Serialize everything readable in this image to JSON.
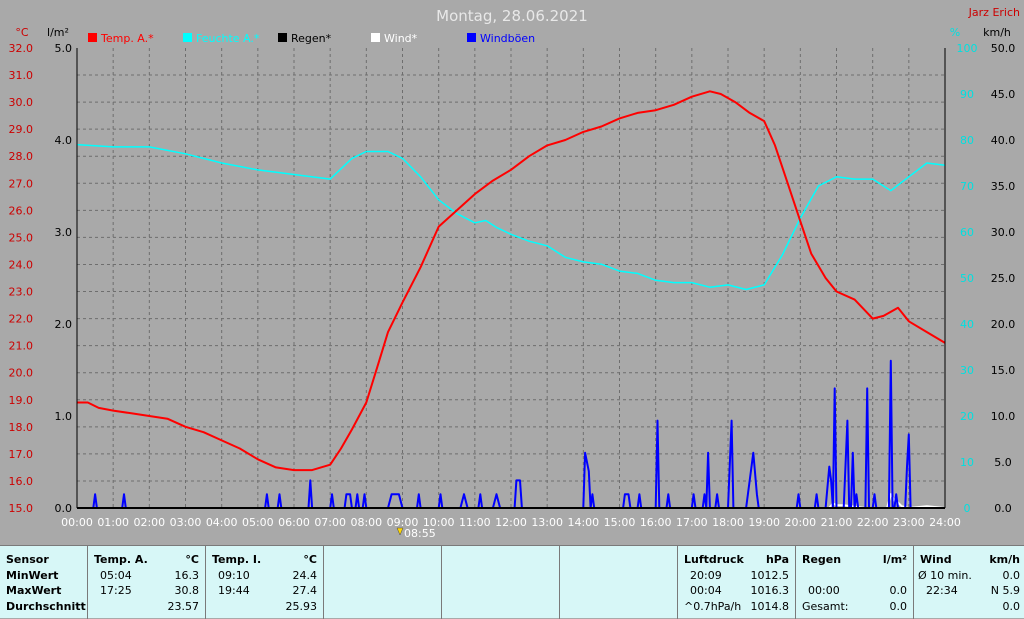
{
  "header": {
    "title": "Montag, 28.06.2021",
    "author": "Jarz Erich",
    "unit_left_temp": "°C",
    "unit_left_rain": "l/m²",
    "unit_right_hum": "%",
    "unit_right_wind": "km/h",
    "time_marker": "08:55"
  },
  "legend": [
    {
      "label": "Temp. A.*",
      "color": "#ff0000"
    },
    {
      "label": "Feuchte A.*",
      "color": "#00ffff"
    },
    {
      "label": "Regen*",
      "color": "#000000"
    },
    {
      "label": "Wind*",
      "color": "#ffffff"
    },
    {
      "label": "Windböen",
      "color": "#0000ff"
    }
  ],
  "chart_data": {
    "type": "line",
    "title": "Montag, 28.06.2021",
    "x_ticks": [
      "00:00",
      "01:00",
      "02:00",
      "03:00",
      "04:00",
      "05:00",
      "06:00",
      "07:00",
      "08:00",
      "09:00",
      "10:00",
      "11:00",
      "12:00",
      "13:00",
      "14:00",
      "15:00",
      "16:00",
      "17:00",
      "18:00",
      "19:00",
      "20:00",
      "21:00",
      "22:00",
      "23:00",
      "24:00"
    ],
    "xlim_hours": [
      0,
      24
    ],
    "axes": {
      "temp": {
        "label": "°C",
        "lim": [
          15.0,
          32.0
        ],
        "ticks": [
          "32.0",
          "31.0",
          "30.0",
          "29.0",
          "28.0",
          "27.0",
          "26.0",
          "25.0",
          "24.0",
          "23.0",
          "22.0",
          "21.0",
          "20.0",
          "19.0",
          "18.0",
          "17.0",
          "16.0",
          "15.0"
        ]
      },
      "rain": {
        "label": "l/m²",
        "lim": [
          0.0,
          5.0
        ],
        "ticks": [
          "5.0",
          "4.0",
          "3.0",
          "2.0",
          "1.0",
          "0.0"
        ]
      },
      "humidity": {
        "label": "%",
        "lim": [
          0,
          100
        ],
        "ticks": [
          "100",
          "90",
          "80",
          "70",
          "60",
          "50",
          "40",
          "30",
          "20",
          "10",
          "0"
        ]
      },
      "wind": {
        "label": "km/h",
        "lim": [
          0.0,
          50.0
        ],
        "ticks": [
          "50.0",
          "45.0",
          "40.0",
          "35.0",
          "30.0",
          "25.0",
          "20.0",
          "15.0",
          "10.0",
          "5.0",
          "0.0"
        ]
      }
    },
    "grid": true,
    "series": [
      {
        "name": "Temp. A.*",
        "axis": "temp",
        "color": "#ff0000",
        "points": [
          [
            0,
            18.9
          ],
          [
            0.3,
            18.9
          ],
          [
            0.6,
            18.7
          ],
          [
            1,
            18.6
          ],
          [
            1.5,
            18.5
          ],
          [
            2,
            18.4
          ],
          [
            2.5,
            18.3
          ],
          [
            3,
            18.0
          ],
          [
            3.5,
            17.8
          ],
          [
            4,
            17.5
          ],
          [
            4.5,
            17.2
          ],
          [
            5,
            16.8
          ],
          [
            5.5,
            16.5
          ],
          [
            6,
            16.4
          ],
          [
            6.5,
            16.4
          ],
          [
            7,
            16.6
          ],
          [
            7.3,
            17.2
          ],
          [
            7.6,
            17.9
          ],
          [
            8,
            18.9
          ],
          [
            8.3,
            20.2
          ],
          [
            8.6,
            21.5
          ],
          [
            9,
            22.6
          ],
          [
            9.5,
            23.9
          ],
          [
            10,
            25.4
          ],
          [
            10.5,
            26.0
          ],
          [
            11,
            26.6
          ],
          [
            11.5,
            27.1
          ],
          [
            12,
            27.5
          ],
          [
            12.5,
            28.0
          ],
          [
            13,
            28.4
          ],
          [
            13.5,
            28.6
          ],
          [
            14,
            28.9
          ],
          [
            14.5,
            29.1
          ],
          [
            15,
            29.4
          ],
          [
            15.5,
            29.6
          ],
          [
            16,
            29.7
          ],
          [
            16.5,
            29.9
          ],
          [
            17,
            30.2
          ],
          [
            17.5,
            30.4
          ],
          [
            17.8,
            30.3
          ],
          [
            18.2,
            30.0
          ],
          [
            18.6,
            29.6
          ],
          [
            19,
            29.3
          ],
          [
            19.3,
            28.4
          ],
          [
            19.6,
            27.2
          ],
          [
            20,
            25.6
          ],
          [
            20.3,
            24.4
          ],
          [
            20.7,
            23.5
          ],
          [
            21,
            23.0
          ],
          [
            21.5,
            22.7
          ],
          [
            22,
            22.0
          ],
          [
            22.3,
            22.1
          ],
          [
            22.7,
            22.4
          ],
          [
            23,
            21.9
          ],
          [
            23.5,
            21.5
          ],
          [
            24,
            21.1
          ]
        ]
      },
      {
        "name": "Feuchte A.*",
        "axis": "humidity",
        "color": "#00ffff",
        "points": [
          [
            0,
            79
          ],
          [
            1,
            78.5
          ],
          [
            2,
            78.5
          ],
          [
            3,
            77
          ],
          [
            4,
            75
          ],
          [
            5,
            73.5
          ],
          [
            6,
            72.5
          ],
          [
            7,
            71.5
          ],
          [
            7.6,
            76
          ],
          [
            8,
            77.5
          ],
          [
            8.6,
            77.5
          ],
          [
            9,
            76
          ],
          [
            9.5,
            72
          ],
          [
            10,
            67
          ],
          [
            10.5,
            64
          ],
          [
            11,
            62
          ],
          [
            11.3,
            62.5
          ],
          [
            11.6,
            61
          ],
          [
            12,
            59.5
          ],
          [
            12.5,
            58
          ],
          [
            13,
            57
          ],
          [
            13.5,
            54.5
          ],
          [
            14,
            53.5
          ],
          [
            14.5,
            53
          ],
          [
            15,
            51.5
          ],
          [
            15.5,
            51
          ],
          [
            16,
            49.5
          ],
          [
            16.5,
            49
          ],
          [
            17,
            49
          ],
          [
            17.5,
            48
          ],
          [
            18,
            48.5
          ],
          [
            18.5,
            47.5
          ],
          [
            19,
            48.5
          ],
          [
            19.5,
            55
          ],
          [
            20,
            63
          ],
          [
            20.5,
            70
          ],
          [
            21,
            72
          ],
          [
            21.5,
            71.5
          ],
          [
            22,
            71.5
          ],
          [
            22.5,
            69
          ],
          [
            23,
            72
          ],
          [
            23.5,
            75
          ],
          [
            24,
            74.5
          ]
        ]
      },
      {
        "name": "Windböen",
        "axis": "wind",
        "color": "#0000ff",
        "points": [
          [
            0,
            0
          ],
          [
            0.45,
            0
          ],
          [
            0.5,
            1.5
          ],
          [
            0.55,
            0
          ],
          [
            1.25,
            0
          ],
          [
            1.3,
            1.5
          ],
          [
            1.35,
            0
          ],
          [
            5.2,
            0
          ],
          [
            5.25,
            1.5
          ],
          [
            5.3,
            0
          ],
          [
            5.55,
            0
          ],
          [
            5.6,
            1.5
          ],
          [
            5.65,
            0
          ],
          [
            6.4,
            0
          ],
          [
            6.45,
            3
          ],
          [
            6.5,
            0
          ],
          [
            7.0,
            0
          ],
          [
            7.05,
            1.5
          ],
          [
            7.1,
            0
          ],
          [
            7.4,
            0
          ],
          [
            7.45,
            1.5
          ],
          [
            7.55,
            1.5
          ],
          [
            7.6,
            0
          ],
          [
            7.7,
            0
          ],
          [
            7.75,
            1.5
          ],
          [
            7.8,
            0
          ],
          [
            7.9,
            0
          ],
          [
            7.95,
            1.5
          ],
          [
            8.0,
            0
          ],
          [
            8.6,
            0
          ],
          [
            8.7,
            1.5
          ],
          [
            8.9,
            1.5
          ],
          [
            9.0,
            0
          ],
          [
            9.4,
            0
          ],
          [
            9.45,
            1.5
          ],
          [
            9.5,
            0
          ],
          [
            10.0,
            0
          ],
          [
            10.05,
            1.5
          ],
          [
            10.1,
            0
          ],
          [
            10.6,
            0
          ],
          [
            10.7,
            1.5
          ],
          [
            10.8,
            0
          ],
          [
            11.1,
            0
          ],
          [
            11.15,
            1.5
          ],
          [
            11.2,
            0
          ],
          [
            11.5,
            0
          ],
          [
            11.6,
            1.5
          ],
          [
            11.7,
            0
          ],
          [
            12.1,
            0
          ],
          [
            12.15,
            3
          ],
          [
            12.25,
            3
          ],
          [
            12.3,
            0
          ],
          [
            14.0,
            0
          ],
          [
            14.05,
            6
          ],
          [
            14.15,
            4
          ],
          [
            14.2,
            0
          ],
          [
            14.25,
            1.5
          ],
          [
            14.3,
            0
          ],
          [
            15.1,
            0
          ],
          [
            15.15,
            1.5
          ],
          [
            15.25,
            1.5
          ],
          [
            15.3,
            0
          ],
          [
            15.5,
            0
          ],
          [
            15.55,
            1.5
          ],
          [
            15.6,
            0
          ],
          [
            16.0,
            0
          ],
          [
            16.05,
            9.5
          ],
          [
            16.1,
            0
          ],
          [
            16.3,
            0
          ],
          [
            16.35,
            1.5
          ],
          [
            16.4,
            0
          ],
          [
            17.0,
            0
          ],
          [
            17.05,
            1.5
          ],
          [
            17.1,
            0
          ],
          [
            17.3,
            0
          ],
          [
            17.35,
            1.5
          ],
          [
            17.4,
            0
          ],
          [
            17.45,
            6
          ],
          [
            17.5,
            0
          ],
          [
            17.65,
            0
          ],
          [
            17.7,
            1.5
          ],
          [
            17.75,
            0
          ],
          [
            18.0,
            0
          ],
          [
            18.1,
            9.5
          ],
          [
            18.15,
            0
          ],
          [
            18.5,
            0
          ],
          [
            18.55,
            1.5
          ],
          [
            18.7,
            6
          ],
          [
            18.8,
            1.5
          ],
          [
            18.85,
            0
          ],
          [
            19.9,
            0
          ],
          [
            19.95,
            1.5
          ],
          [
            20.0,
            0
          ],
          [
            20.4,
            0
          ],
          [
            20.45,
            1.5
          ],
          [
            20.5,
            0
          ],
          [
            20.7,
            0
          ],
          [
            20.8,
            4.5
          ],
          [
            20.85,
            3
          ],
          [
            20.9,
            0
          ],
          [
            20.95,
            13
          ],
          [
            21.0,
            0
          ],
          [
            21.2,
            0
          ],
          [
            21.3,
            9.5
          ],
          [
            21.35,
            0
          ],
          [
            21.4,
            0
          ],
          [
            21.45,
            6
          ],
          [
            21.5,
            0
          ],
          [
            21.55,
            1.5
          ],
          [
            21.6,
            0
          ],
          [
            21.8,
            0
          ],
          [
            21.85,
            13
          ],
          [
            21.9,
            0
          ],
          [
            22.0,
            0
          ],
          [
            22.05,
            1.5
          ],
          [
            22.1,
            0
          ],
          [
            22.45,
            0
          ],
          [
            22.5,
            16
          ],
          [
            22.55,
            0
          ],
          [
            22.6,
            0
          ],
          [
            22.65,
            1.5
          ],
          [
            22.7,
            0
          ],
          [
            22.9,
            0
          ],
          [
            22.95,
            4.5
          ],
          [
            23.0,
            8
          ],
          [
            23.05,
            0
          ],
          [
            24,
            0
          ]
        ]
      },
      {
        "name": "Wind*",
        "axis": "wind",
        "color": "#ffffff",
        "points": [
          [
            20.8,
            0
          ],
          [
            20.9,
            0.5
          ],
          [
            21.0,
            0.3
          ],
          [
            21.2,
            0.3
          ],
          [
            21.4,
            0.2
          ],
          [
            21.6,
            0.1
          ],
          [
            21.8,
            0
          ],
          [
            22.4,
            0
          ],
          [
            22.5,
            1.5
          ],
          [
            22.6,
            0.8
          ],
          [
            22.7,
            0.6
          ],
          [
            22.8,
            0.2
          ],
          [
            23.0,
            0
          ],
          [
            23.5,
            0.2
          ],
          [
            24,
            0
          ]
        ]
      },
      {
        "name": "Regen*",
        "axis": "rain",
        "color": "#000000",
        "points": [
          [
            0,
            0
          ],
          [
            24,
            0
          ]
        ]
      }
    ]
  },
  "table": {
    "sensor": {
      "header": "Sensor",
      "rows": [
        "MinWert",
        "MaxWert",
        "Durchschnitt"
      ]
    },
    "temp_a": {
      "header": "Temp. A.",
      "unit": "°C",
      "times": [
        "05:04",
        "17:25",
        ""
      ],
      "values": [
        "16.3",
        "30.8",
        "23.57"
      ]
    },
    "temp_i": {
      "header": "Temp. I.",
      "unit": "°C",
      "times": [
        "09:10",
        "19:44",
        ""
      ],
      "values": [
        "24.4",
        "27.4",
        "25.93"
      ]
    },
    "pressure": {
      "header": "Luftdruck",
      "unit": "hPa",
      "times": [
        "20:09",
        "00:04",
        "^0.7hPa/h"
      ],
      "values": [
        "1012.5",
        "1016.3",
        "1014.8"
      ]
    },
    "rain": {
      "header": "Regen",
      "unit": "l/m²",
      "times": [
        "",
        "00:00",
        "Gesamt:"
      ],
      "values": [
        "",
        "0.0",
        "0.0"
      ]
    },
    "wind": {
      "header": "Wind",
      "unit": "km/h",
      "times": [
        "Ø 10 min.",
        "22:34",
        ""
      ],
      "values": [
        "0.0",
        "N 5.9",
        "0.0"
      ]
    }
  }
}
